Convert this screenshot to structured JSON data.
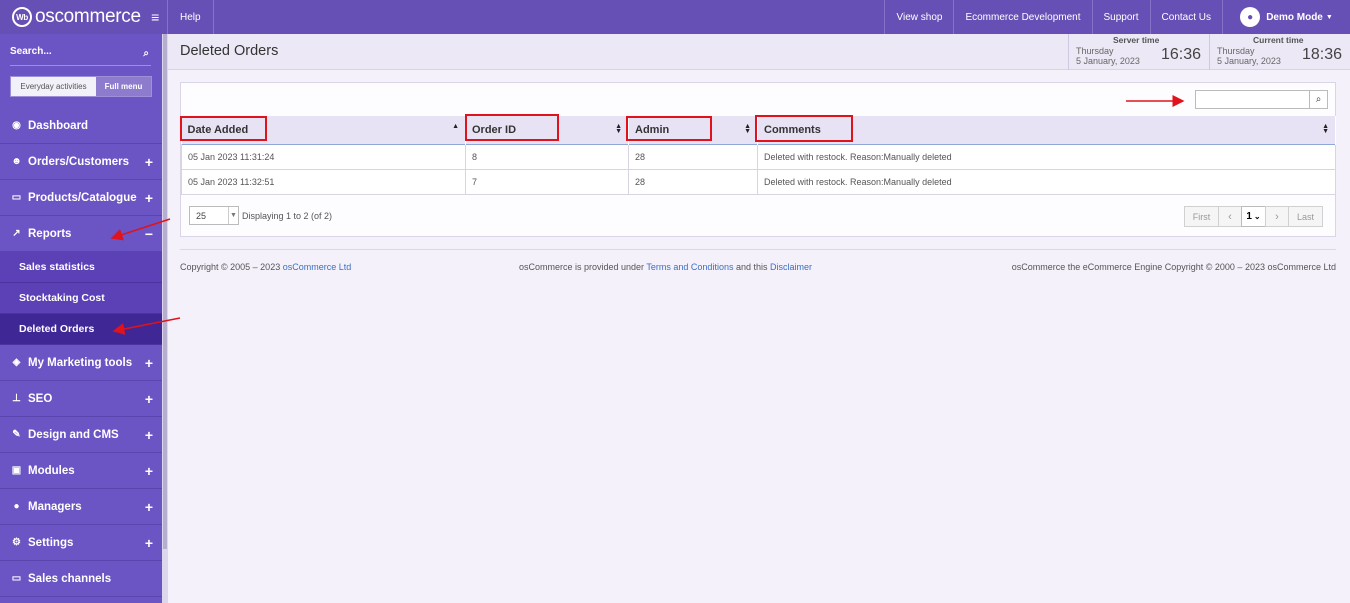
{
  "topbar": {
    "logo_text": "oscommerce",
    "logo_mark": "Wb",
    "help": "Help",
    "links": [
      "View shop",
      "Ecommerce Development",
      "Support",
      "Contact Us"
    ],
    "user": "Demo Mode"
  },
  "sidebar": {
    "search_placeholder": "Search...",
    "toggle": [
      "Everyday activities",
      "Full menu"
    ],
    "items": [
      {
        "label": "Dashboard",
        "icon": "dashboard-icon",
        "expand": ""
      },
      {
        "label": "Orders/Customers",
        "icon": "users-icon",
        "expand": "+"
      },
      {
        "label": "Products/Catalogue",
        "icon": "folder-icon",
        "expand": "+"
      },
      {
        "label": "Reports",
        "icon": "chart-icon",
        "expand": "−"
      },
      {
        "label": "My Marketing tools",
        "icon": "tag-icon",
        "expand": "+"
      },
      {
        "label": "SEO",
        "icon": "sitemap-icon",
        "expand": "+"
      },
      {
        "label": "Design and CMS",
        "icon": "brush-icon",
        "expand": "+"
      },
      {
        "label": "Modules",
        "icon": "puzzle-icon",
        "expand": "+"
      },
      {
        "label": "Managers",
        "icon": "user-icon",
        "expand": "+"
      },
      {
        "label": "Settings",
        "icon": "gears-icon",
        "expand": "+"
      },
      {
        "label": "Sales channels",
        "icon": "monitor-icon",
        "expand": ""
      }
    ],
    "reports_sub": [
      "Sales statistics",
      "Stocktaking Cost",
      "Deleted Orders"
    ]
  },
  "header": {
    "title": "Deleted Orders",
    "server": {
      "label": "Server time",
      "day": "Thursday",
      "date": "5 January, 2023",
      "time": "16:36"
    },
    "current": {
      "label": "Current time",
      "day": "Thursday",
      "date": "5 January, 2023",
      "time": "18:36"
    }
  },
  "table": {
    "columns": [
      "Date Added",
      "Order ID",
      "Admin",
      "Comments"
    ],
    "rows": [
      [
        "05 Jan 2023 11:31:24",
        "8",
        "28",
        "Deleted with restock. Reason:Manually deleted"
      ],
      [
        "05 Jan 2023 11:32:51",
        "7",
        "28",
        "Deleted with restock. Reason:Manually deleted"
      ]
    ],
    "search_value": ""
  },
  "paging": {
    "per_page": "25",
    "info": "Displaying 1 to 2 (of 2)",
    "first": "First",
    "prev": "‹",
    "current": "1",
    "next": "›",
    "last": "Last"
  },
  "footer": {
    "copyright_prefix": "Copyright © 2005 – 2023 ",
    "copyright_link": "osCommerce Ltd",
    "middle_a": "osCommerce is provided under ",
    "terms": "Terms and Conditions",
    "middle_b": " and this ",
    "disclaimer": "Disclaimer",
    "right": "osCommerce the eCommerce Engine Copyright © 2000 – 2023 osCommerce Ltd"
  },
  "colors": {
    "brand": "#6650b5",
    "sidebar": "#6b54c3",
    "annotation": "#e0131d"
  }
}
